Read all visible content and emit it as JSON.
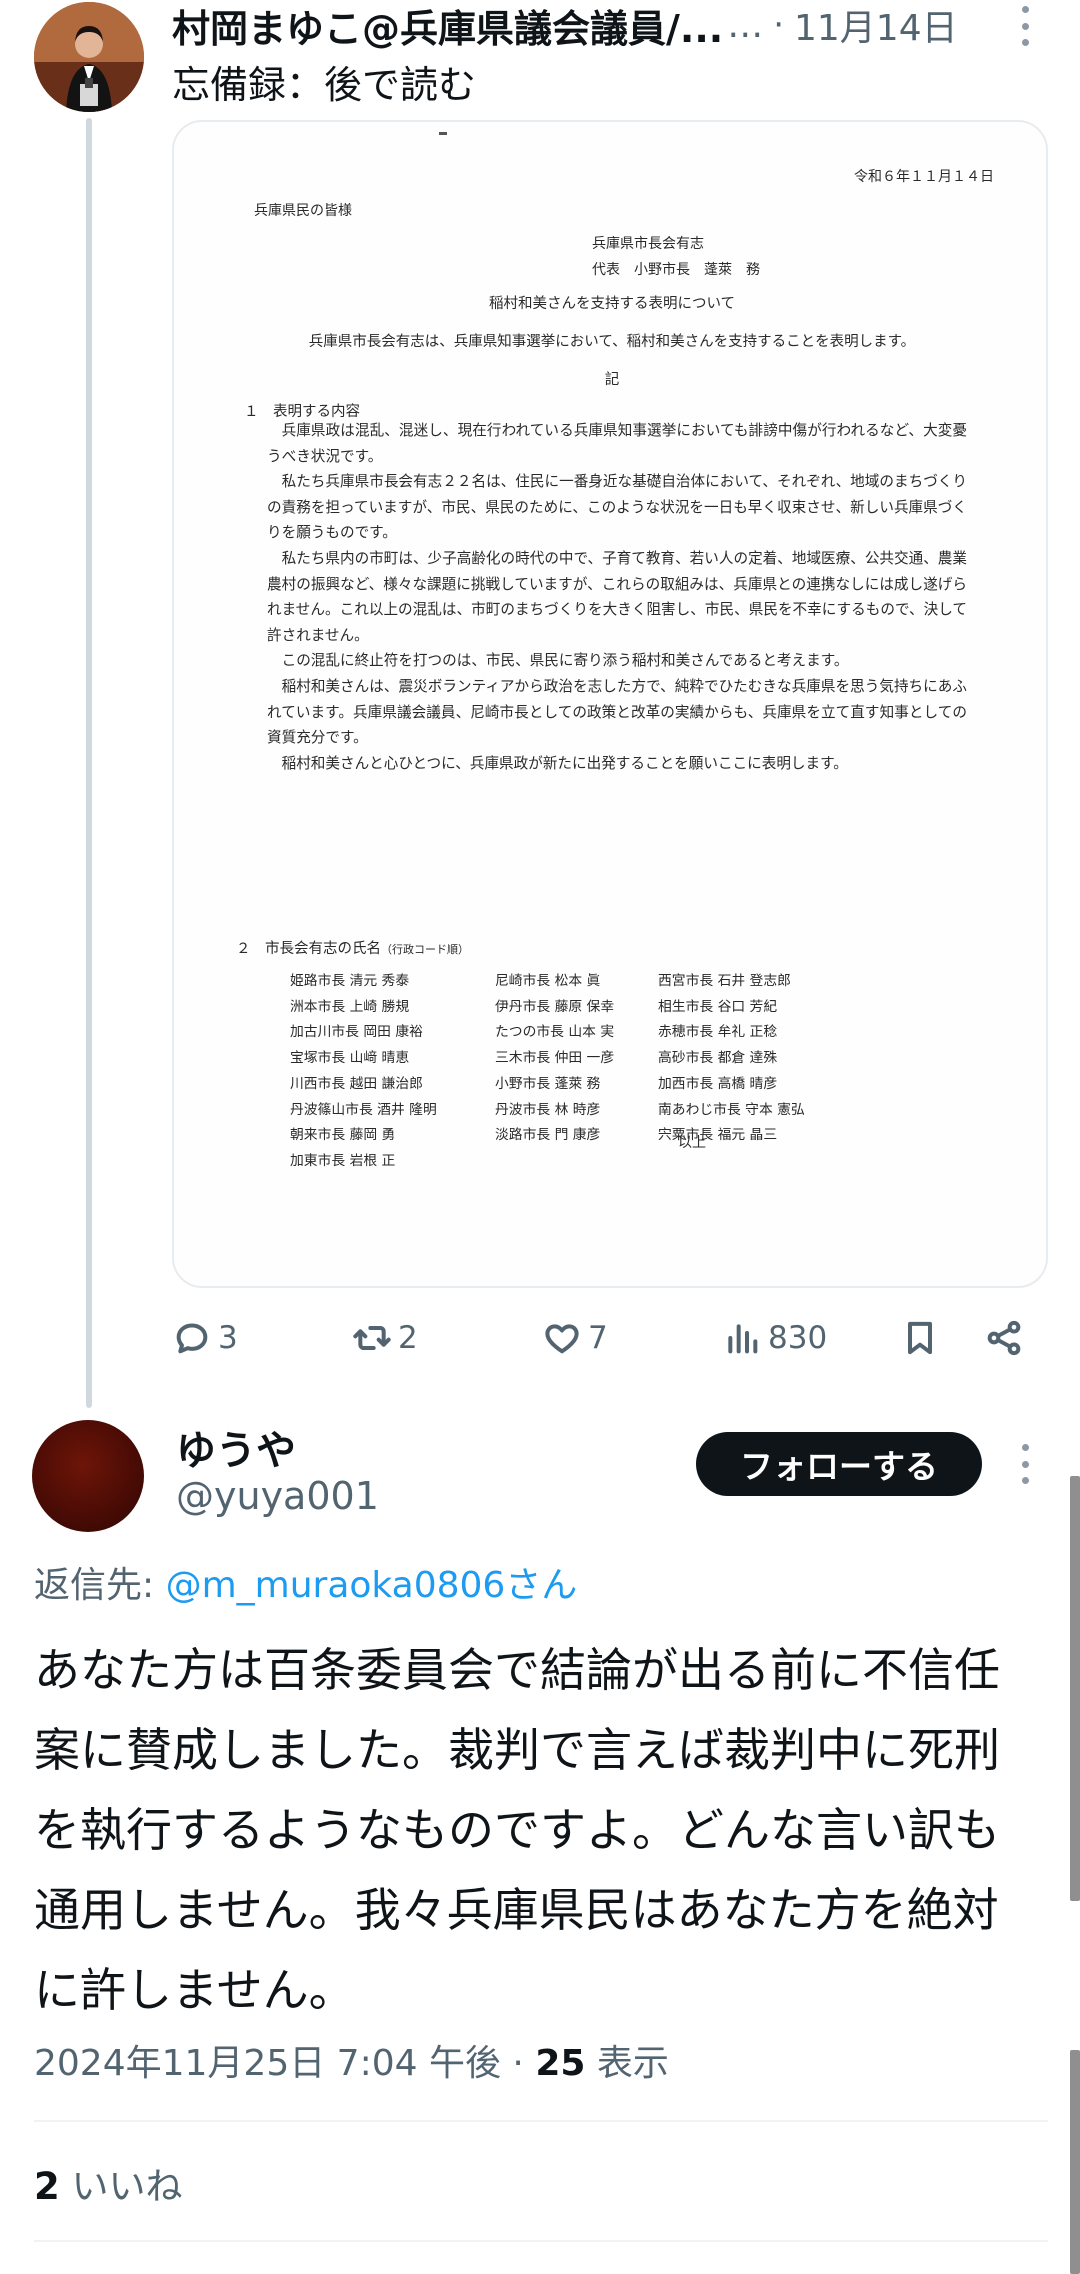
{
  "parent_tweet": {
    "display_name": "村岡まゆこ@兵庫県議会議員/...",
    "more_ellipsis": "…",
    "separator": "·",
    "date": "11月14日",
    "text": "忘備録：後で読む",
    "attachment_document": {
      "date": "令和６年１１月１４日",
      "addressee": "兵庫県民の皆様",
      "sender_group": "兵庫県市長会有志",
      "sender_rep": "代表　小野市長　蓬萊　務",
      "title": "稲村和美さんを支持する表明について",
      "statement": "兵庫県市長会有志は、兵庫県知事選挙において、稲村和美さんを支持することを表明します。",
      "ki": "記",
      "section1_heading": "１　表明する内容",
      "paragraphs": [
        "兵庫県政は混乱、混迷し、現在行われている兵庫県知事選挙においても誹謗中傷が行われるなど、大変憂うべき状況です。",
        "私たち兵庫県市長会有志２２名は、住民に一番身近な基礎自治体において、それぞれ、地域のまちづくりの責務を担っていますが、市民、県民のために、このような状況を一日も早く収束させ、新しい兵庫県づくりを願うものです。",
        "私たち県内の市町は、少子高齢化の時代の中で、子育て教育、若い人の定着、地域医療、公共交通、農業農村の振興など、様々な課題に挑戦していますが、これらの取組みは、兵庫県との連携なしには成し遂げられません。これ以上の混乱は、市町のまちづくりを大きく阻害し、市民、県民を不幸にするもので、決して許されません。",
        "この混乱に終止符を打つのは、市民、県民に寄り添う稲村和美さんであると考えます。",
        "稲村和美さんは、震災ボランティアから政治を志した方で、純粋でひたむきな兵庫県を思う気持ちにあふれています。兵庫県議会議員、尼崎市長としての政策と改革の実績からも、兵庫県を立て直す知事としての資質充分です。",
        "稲村和美さんと心ひとつに、兵庫県政が新たに出発することを願いここに表明します。"
      ],
      "section2_heading": "２　市長会有志の氏名",
      "section2_note": "（行政コード順）",
      "mayors": [
        "姫路市長 清元 秀泰",
        "尼崎市長 松本 眞",
        "西宮市長 石井 登志郎",
        "洲本市長 上崎 勝規",
        "伊丹市長 藤原 保幸",
        "相生市長 谷口 芳紀",
        "加古川市長 岡田 康裕",
        "たつの市長 山本 実",
        "赤穂市長 牟礼 正稔",
        "宝塚市長 山﨑 晴恵",
        "三木市長 仲田 一彦",
        "高砂市長 都倉 達殊",
        "川西市長 越田 謙治郎",
        "小野市長 蓬萊 務",
        "加西市長 高橋 晴彦",
        "丹波篠山市長 酒井 隆明",
        "丹波市長 林 時彦",
        "南あわじ市長 守本 憲弘",
        "朝来市長 藤岡 勇",
        "淡路市長 門 康彦",
        "宍粟市長 福元 晶三",
        "加東市長 岩根 正",
        "",
        ""
      ],
      "closing": "以上"
    },
    "actions": {
      "reply_count": "3",
      "retweet_count": "2",
      "like_count": "7",
      "views_count": "830"
    }
  },
  "reply_tweet": {
    "display_name": "ゆうや",
    "handle": "@yuya001",
    "follow_label": "フォローする",
    "reply_to_prefix": "返信先: ",
    "reply_to_mention": "@m_muraoka0806さん",
    "body": "あなた方は百条委員会で結論が出る前に不信任案に賛成しました。裁判で言えば裁判中に死刑を執行するようなものですよ。どんな言い訳も通用しません。我々兵庫県民はあなた方を絶対に許しません。",
    "timestamp": "2024年11月25日 7:04 午後",
    "meta_separator": " · ",
    "views_count": "25",
    "views_label": " 表示",
    "likes_count": "2",
    "likes_label": " いいね"
  }
}
